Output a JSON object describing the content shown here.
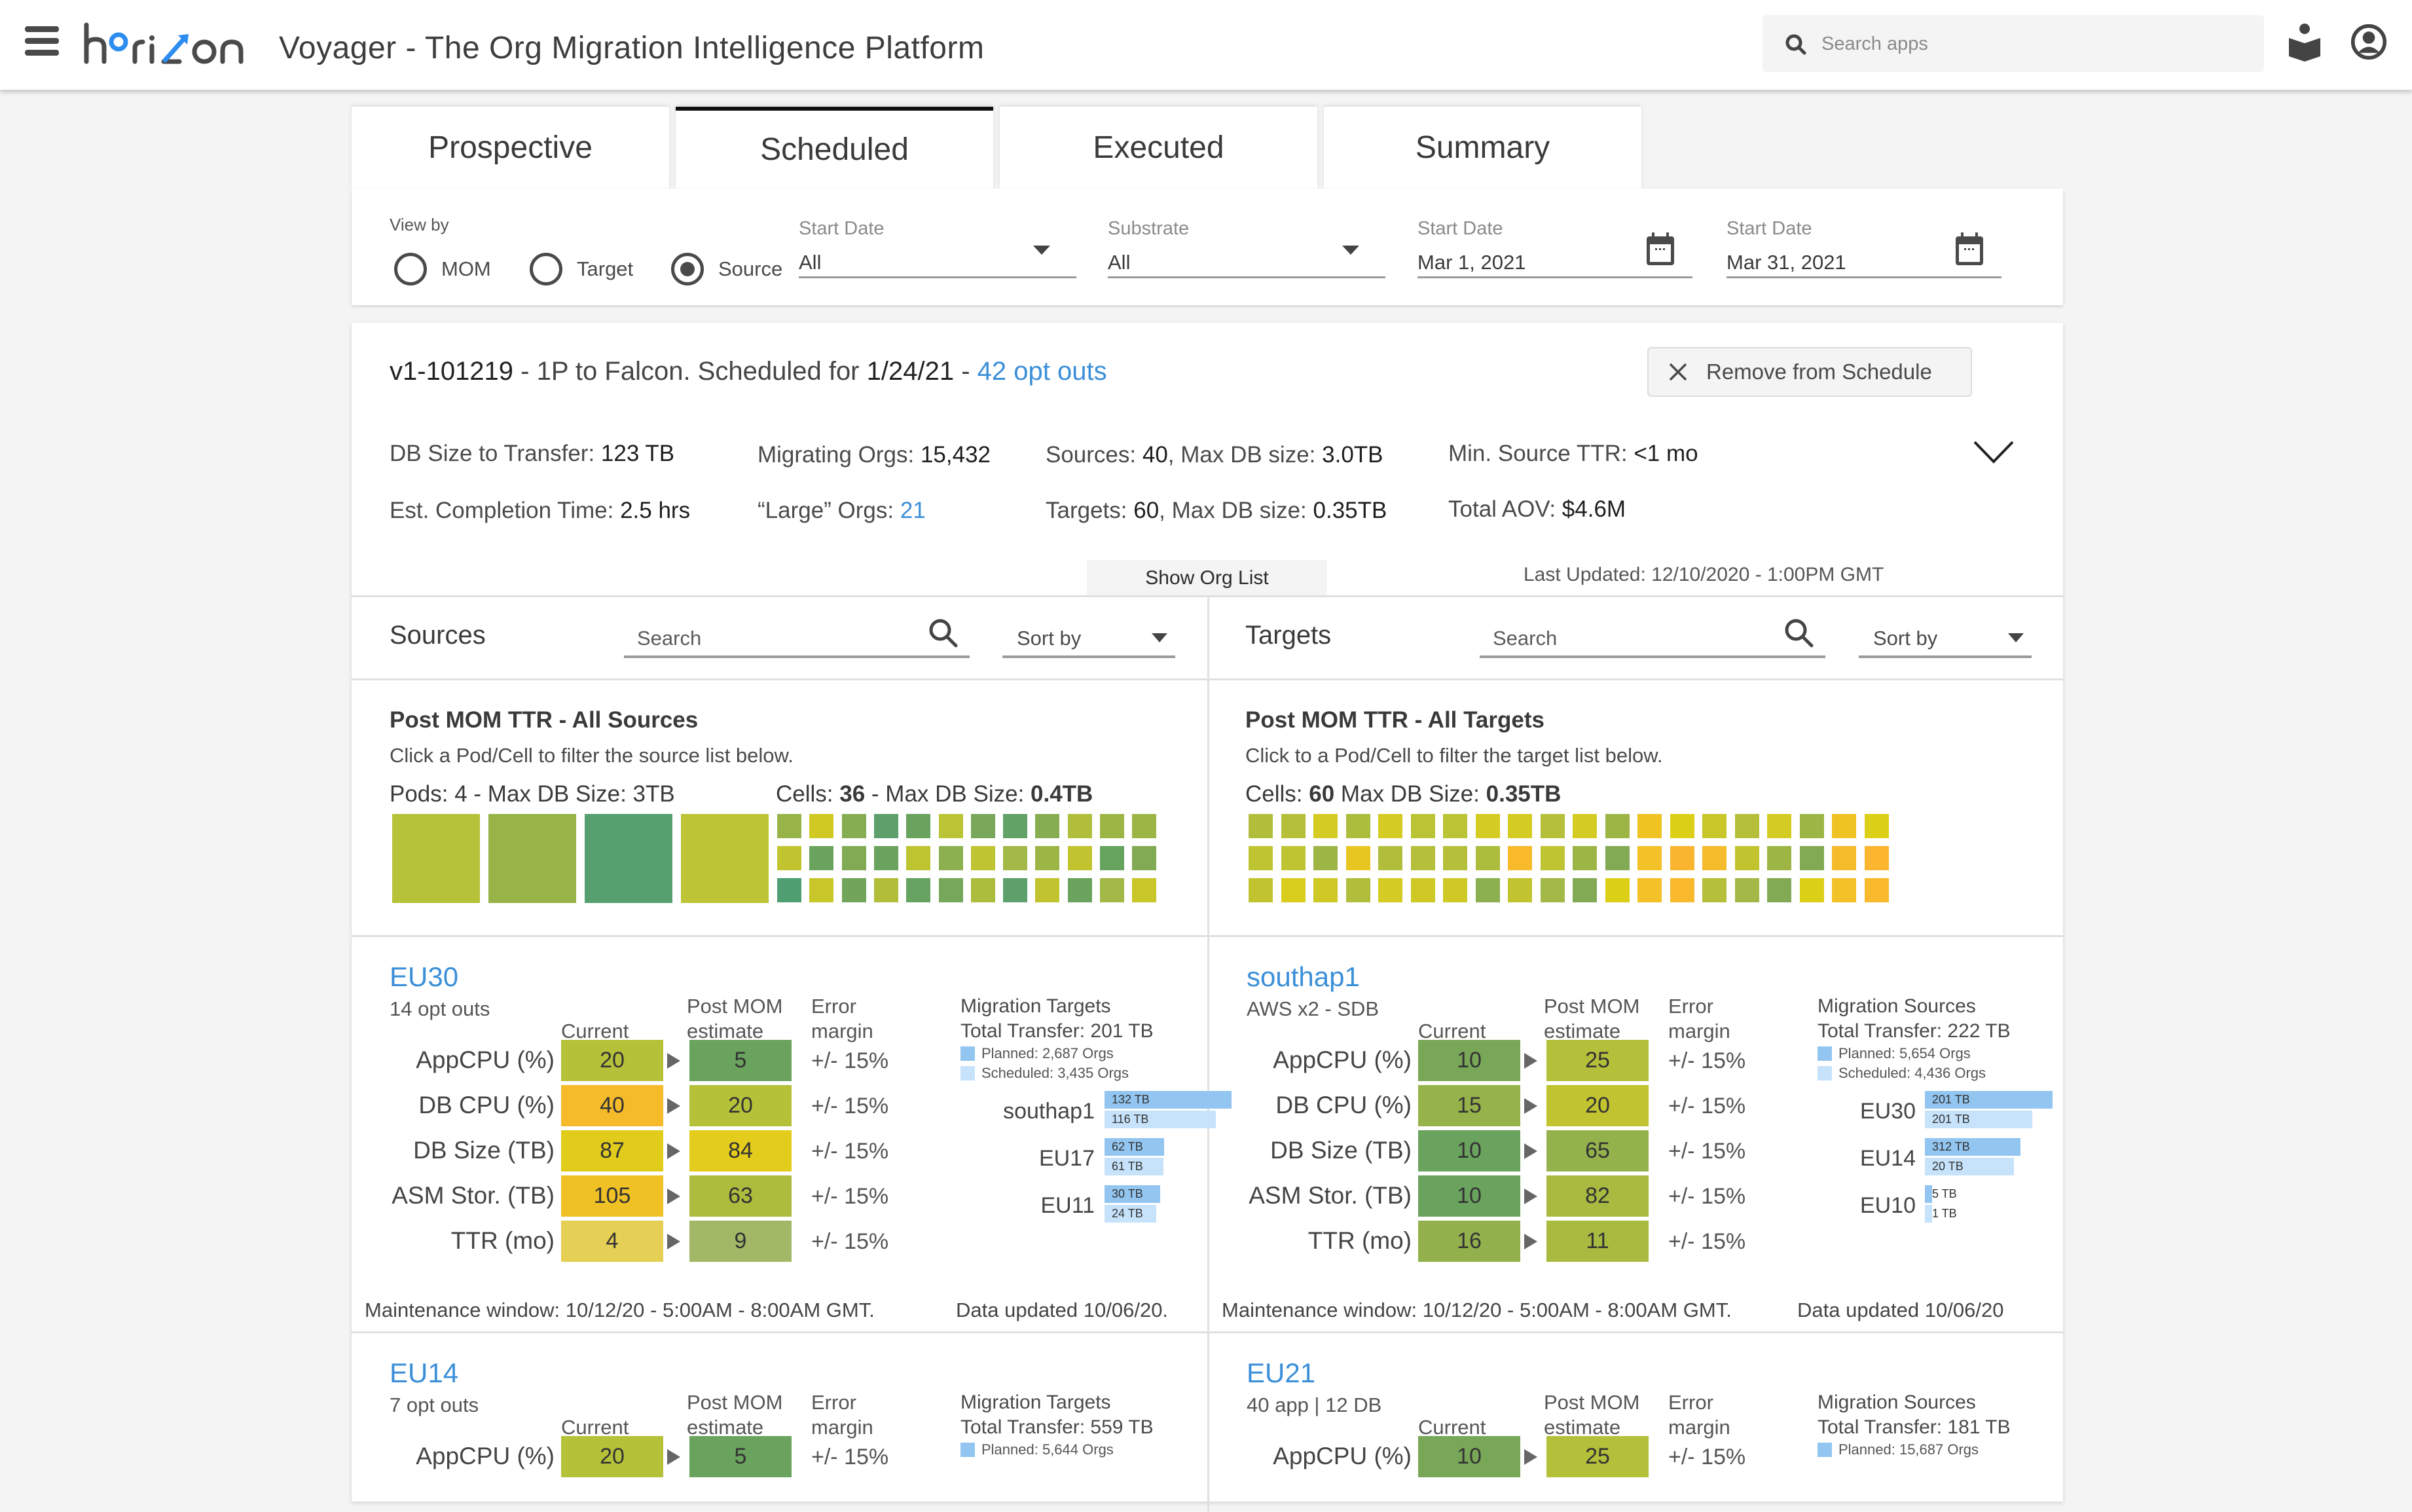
{
  "header": {
    "app_title": "Voyager - The Org Migration Intelligence Platform",
    "logo_text": "horizon",
    "search": {
      "placeholder": "Search apps",
      "value": ""
    },
    "icons": [
      "menu-icon",
      "search-icon",
      "learning-book-icon",
      "user-avatar-icon"
    ],
    "brand_color": "#2d8cf0"
  },
  "tabs": [
    {
      "label": "Prospective",
      "active": false
    },
    {
      "label": "Scheduled",
      "active": true
    },
    {
      "label": "Executed",
      "active": false
    },
    {
      "label": "Summary",
      "active": false
    }
  ],
  "filters": {
    "view_by_label": "View by",
    "radios": [
      {
        "label": "MOM",
        "checked": false
      },
      {
        "label": "Target",
        "checked": false
      },
      {
        "label": "Source",
        "checked": true
      }
    ],
    "start_date_select": {
      "label": "Start Date",
      "value": "All"
    },
    "substrate_select": {
      "label": "Substrate",
      "value": "All"
    },
    "start_date_from": {
      "label": "Start Date",
      "value": "Mar 1, 2021"
    },
    "start_date_to": {
      "label": "Start Date",
      "value": "Mar 31, 2021"
    }
  },
  "migration": {
    "id": "v1-101219",
    "description": " - 1P to Falcon. Scheduled for ",
    "date": "1/24/21",
    "sep": " - ",
    "opt_outs": "42 opt outs",
    "remove_button": "Remove from Schedule",
    "stats": {
      "db_size_label": "DB Size to Transfer: ",
      "db_size": "123 TB",
      "completion_label": "Est. Completion Time: ",
      "completion": "2.5 hrs",
      "migrating_label": "Migrating Orgs: ",
      "migrating": "15,432",
      "large_label": "“Large” Orgs: ",
      "large": "21",
      "sources_label": "Sources: ",
      "sources": "40",
      "sources_max_label": ", Max DB size: ",
      "sources_max": "3.0TB",
      "targets_label": "Targets: ",
      "targets": "60",
      "targets_max_label": ", Max DB size: ",
      "targets_max": "0.35TB",
      "min_ttr_label": "Min. Source TTR: ",
      "min_ttr": "<1 mo",
      "aov_label": "Total AOV: ",
      "aov": "$4.6M"
    },
    "show_org_list": "Show Org List",
    "last_updated": "Last Updated: 12/10/2020 - 1:00PM  GMT"
  },
  "sources_panel": {
    "title": "Sources",
    "search_placeholder": "Search",
    "sort_label": "Sort by",
    "heatmap_title": "Post MOM TTR - All Sources",
    "heatmap_sub": "Click a Pod/Cell to filter the source list below.",
    "pods_label": "Pods: 4 - Max DB Size: 3TB",
    "cells_prefix": "Cells: ",
    "cells_count": "36",
    "cells_mid": " - Max DB Size: ",
    "cells_max": "0.4TB",
    "pods": [
      "#b5c23a",
      "#98b448",
      "#55a06e",
      "#bdc435"
    ],
    "cells": [
      [
        "#98b448",
        "#d0c923",
        "#86ad52",
        "#5da06b",
        "#6aa35e",
        "#bac434",
        "#7aa85a",
        "#62a266",
        "#86ad52",
        "#b1be3b",
        "#9db545",
        "#9db545"
      ],
      [
        "#c2c42f",
        "#6aa35e",
        "#80aa54",
        "#6aa35e",
        "#bec430",
        "#8caf4f",
        "#bec432",
        "#a2b847",
        "#9db545",
        "#c2c42f",
        "#66a35f",
        "#82aa55"
      ],
      [
        "#4f9f72",
        "#c9c62a",
        "#72a55a",
        "#b2be3a",
        "#66a362",
        "#76a75a",
        "#acbc3d",
        "#5da06b",
        "#c2c42f",
        "#6aa35e",
        "#a2b847",
        "#c9c62a"
      ]
    ]
  },
  "targets_panel": {
    "title": "Targets",
    "search_placeholder": "Search",
    "sort_label": "Sort by",
    "heatmap_title": "Post MOM TTR - All Targets",
    "heatmap_sub": "Click to a Pod/Cell to filter the target list below.",
    "cells_prefix": "Cells: ",
    "cells_count": "60",
    "cells_mid": "  Max DB Size: ",
    "cells_max": "0.35TB",
    "cells": [
      [
        "#b1be3b",
        "#b5bf3a",
        "#d4cc22",
        "#acbc3d",
        "#d4cc22",
        "#bac434",
        "#bac434",
        "#d4cc22",
        "#d4cc22",
        "#b5bf3a",
        "#d4cc22",
        "#9db545",
        "#efc322",
        "#dccf18",
        "#c9c62a",
        "#b5bf3a",
        "#d4cc22",
        "#9db545",
        "#efc322",
        "#dccf18"
      ],
      [
        "#bec432",
        "#bec432",
        "#9db545",
        "#e8c622",
        "#b1be3b",
        "#b5bf3a",
        "#b5bf3a",
        "#acbc3d",
        "#f8ba2a",
        "#bec432",
        "#9db545",
        "#82aa55",
        "#f3c128",
        "#fab530",
        "#f6bb2a",
        "#c2c42f",
        "#9db545",
        "#82aa55",
        "#f6bb2a",
        "#fbb52f"
      ],
      [
        "#c2c42f",
        "#d8cc1c",
        "#cfc926",
        "#b1be3b",
        "#d4cc22",
        "#cfc926",
        "#cfc926",
        "#8caf4f",
        "#c2c42f",
        "#a2b847",
        "#82aa55",
        "#dccf18",
        "#f3c128",
        "#f8b92c",
        "#b5bf3a",
        "#a2b847",
        "#82aa55",
        "#dccf18",
        "#f3c128",
        "#f8b92c"
      ]
    ]
  },
  "node_cards": [
    {
      "name": "EU30",
      "subtitle": "14 opt outs",
      "col_current": "Current",
      "col_post": "Post MOM\nestimate",
      "col_error": "Error\nmargin",
      "metrics": [
        {
          "label": "AppCPU (%)",
          "current": "20",
          "current_color": "#b6c13a",
          "post": "5",
          "post_color": "#6aa35e",
          "error": "+/- 15%"
        },
        {
          "label": "DB CPU (%)",
          "current": "40",
          "current_color": "#f6bb2a",
          "post": "20",
          "post_color": "#b6c13a",
          "error": "+/- 15%"
        },
        {
          "label": "DB Size (TB)",
          "current": "87",
          "current_color": "#e1cc1c",
          "post": "84",
          "post_color": "#e3cc1c",
          "error": "+/- 15%"
        },
        {
          "label": "ASM Stor. (TB)",
          "current": "105",
          "current_color": "#f0c124",
          "post": "63",
          "post_color": "#adbc3d",
          "error": "+/- 15%"
        },
        {
          "label": "TTR (mo)",
          "current": "4",
          "current_color": "#e6cf55",
          "post": "9",
          "post_color": "#a2b866",
          "error": "+/- 15%"
        }
      ],
      "migration_title": "Migration Targets",
      "total_transfer": "Total Transfer: 201 TB",
      "legend_planned": "Planned: 2,687 Orgs",
      "legend_scheduled": "Scheduled: 3,435 Orgs",
      "chart_max": 132,
      "bars": [
        {
          "name": "southap1",
          "planned": 132,
          "planned_label": "132 TB",
          "scheduled": 116,
          "scheduled_label": "116 TB"
        },
        {
          "name": "EU17",
          "planned": 62,
          "planned_label": "62 TB",
          "scheduled": 61,
          "scheduled_label": "61 TB"
        },
        {
          "name": "EU11",
          "planned": 58,
          "planned_label": "30 TB",
          "scheduled": 54,
          "scheduled_label": "24 TB"
        }
      ],
      "maintenance": "Maintenance window: 10/12/20 - 5:00AM - 8:00AM GMT.",
      "data_updated": "Data updated 10/06/20."
    },
    {
      "name": "southap1",
      "subtitle": "AWS x2 - SDB",
      "col_current": "Current",
      "col_post": "Post MOM\nestimate",
      "col_error": "Error\nmargin",
      "metrics": [
        {
          "label": "AppCPU (%)",
          "current": "10",
          "current_color": "#79a758",
          "post": "25",
          "post_color": "#b4bf3a",
          "error": "+/- 15%"
        },
        {
          "label": "DB CPU (%)",
          "current": "15",
          "current_color": "#96b24a",
          "post": "20",
          "post_color": "#c2c330",
          "error": "+/- 15%"
        },
        {
          "label": "DB Size (TB)",
          "current": "10",
          "current_color": "#6aa35e",
          "post": "65",
          "post_color": "#94b24b",
          "error": "+/- 15%"
        },
        {
          "label": "ASM Stor. (TB)",
          "current": "10",
          "current_color": "#6aa35e",
          "post": "82",
          "post_color": "#a8ba40",
          "error": "+/- 15%"
        },
        {
          "label": "TTR (mo)",
          "current": "16",
          "current_color": "#92b14d",
          "post": "11",
          "post_color": "#a8ba40",
          "error": "+/- 15%"
        }
      ],
      "migration_title": "Migration Sources",
      "total_transfer": "Total Transfer: 222 TB",
      "legend_planned": "Planned: 5,654 Orgs",
      "legend_scheduled": "Scheduled: 4,436 Orgs",
      "chart_max": 201,
      "bars": [
        {
          "name": "EU30",
          "planned": 201,
          "planned_label": "201 TB",
          "scheduled": 169,
          "scheduled_label": "201 TB"
        },
        {
          "name": "EU14",
          "planned": 150,
          "planned_label": "312 TB",
          "scheduled": 140,
          "scheduled_label": "20 TB"
        },
        {
          "name": "EU10",
          "planned": 5,
          "planned_label": "5 TB",
          "scheduled": 1,
          "scheduled_label": "1 TB"
        }
      ],
      "maintenance": "Maintenance window: 10/12/20 - 5:00AM - 8:00AM GMT.",
      "data_updated": "Data updated 10/06/20"
    },
    {
      "name": "EU14",
      "subtitle": "7 opt outs",
      "col_current": "Current",
      "col_post": "Post MOM\nestimate",
      "col_error": "Error\nmargin",
      "metrics": [
        {
          "label": "AppCPU (%)",
          "current": "20",
          "current_color": "#b6c13a",
          "post": "5",
          "post_color": "#6aa35e",
          "error": "+/- 15%"
        }
      ],
      "migration_title": "Migration Targets",
      "total_transfer": "Total Transfer: 559 TB",
      "legend_planned": "Planned: 5,644 Orgs"
    },
    {
      "name": "EU21",
      "subtitle": "40 app | 12 DB",
      "col_current": "Current",
      "col_post": "Post MOM\nestimate",
      "col_error": "Error\nmargin",
      "metrics": [
        {
          "label": "AppCPU (%)",
          "current": "10",
          "current_color": "#79a758",
          "post": "25",
          "post_color": "#b4bf3a",
          "error": "+/- 15%"
        }
      ],
      "migration_title": "Migration Sources",
      "total_transfer": "Total Transfer: 181 TB",
      "legend_planned": "Planned: 15,687 Orgs"
    }
  ],
  "colors": {
    "link_blue": "#3b8fd8",
    "planned_bar": "#92c5f0",
    "scheduled_bar": "#c6e3fb"
  }
}
